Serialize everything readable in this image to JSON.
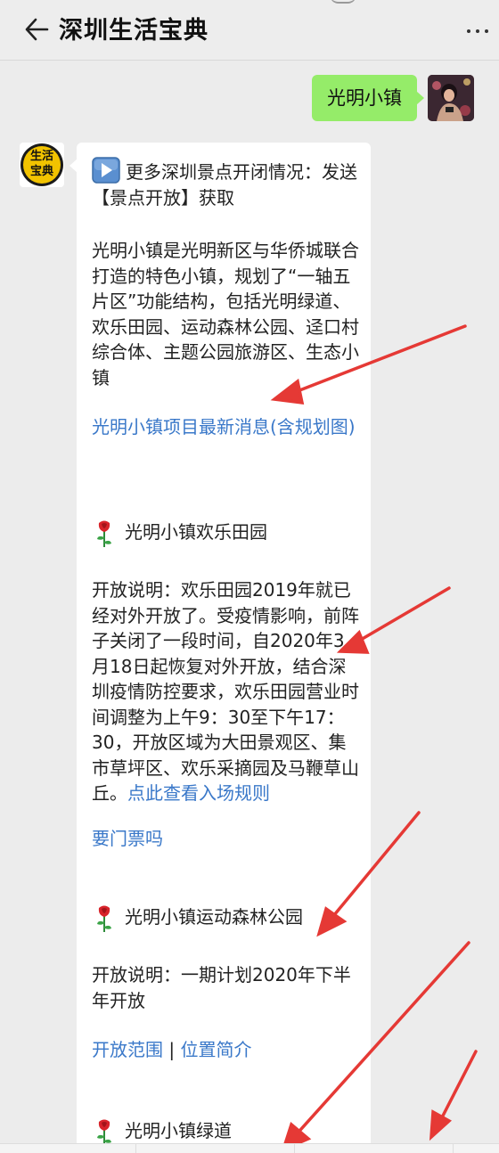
{
  "header": {
    "title": "深圳生活宝典",
    "back_icon": "arrow-left-icon",
    "more_icon": "more-dots-icon"
  },
  "outgoing": {
    "text": "光明小镇"
  },
  "bot": {
    "avatar_text": [
      "生活",
      "宝典"
    ],
    "colors": {
      "avatar_bg": "#f2c300",
      "accent_link": "#3a78c9",
      "arrow": "#e53935"
    }
  },
  "message": {
    "intro_icon": "play-button-icon",
    "intro_text": "更多深圳景点开闭情况：发送【景点开放】获取",
    "description": "光明小镇是光明新区与华侨城联合打造的特色小镇，规划了“一轴五片区”功能结构，包括光明绿道、欢乐田园、运动森林公园、迳口村综合体、主题公园旅游区、生态小镇",
    "news_link": "光明小镇项目最新消息(含规划图)",
    "sections": [
      {
        "title": "光明小镇欢乐田园",
        "body": "开放说明：欢乐田园2019年就已经对外开放了。受疫情影响，前阵子关闭了一段时间，自2020年3月18日起恢复对外开放，结合深圳疫情防控要求，欢乐田园营业时间调整为上午9：30至下午17：30，开放区域为大田景观区、集市草坪区、欢乐采摘园及马鞭草山丘。",
        "inline_link": "点此查看入场规则",
        "extra_link": "要门票吗"
      },
      {
        "title": "光明小镇运动森林公园",
        "body": "开放说明：一期计划2020年下半年开放",
        "link_a": "开放范围",
        "separator": "|",
        "link_b": "位置简介"
      },
      {
        "title": "光明小镇绿道"
      }
    ]
  }
}
